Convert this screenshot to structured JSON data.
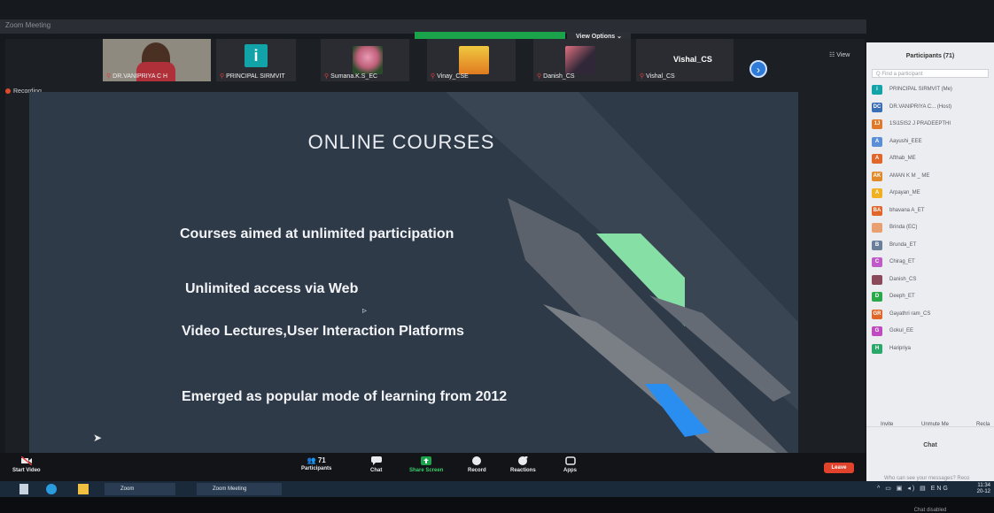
{
  "app": {
    "title": "Zoom Meeting",
    "view_options_label": "View Options ⌄",
    "view_label": "☷ View",
    "recording_label": "Recording"
  },
  "gallery": [
    {
      "name": "DR.VANIPRIYA C H",
      "muted": true
    },
    {
      "name": "PRINCIPAL SIRMVIT",
      "muted": true,
      "initial": "i"
    },
    {
      "name": "Sumana.K.S_EC",
      "muted": true
    },
    {
      "name": "Vinay_CSE",
      "muted": true
    },
    {
      "name": "Danish_CS",
      "muted": true
    },
    {
      "name": "Vishal_CS",
      "muted": true,
      "big_label": "Vishal_CS"
    }
  ],
  "slide": {
    "title": "ONLINE COURSES",
    "bullets": [
      "Courses aimed at unlimited participation",
      "Unlimited access via Web",
      "Video Lectures,User Interaction Platforms",
      "Emerged as popular mode of learning from 2012"
    ],
    "accent_colors": {
      "green": "#86e0a6",
      "blue": "#2a8ef0",
      "background": "#2f3a48",
      "stripe": "#7a7f86"
    }
  },
  "toolbar": {
    "start_video": "Start Video",
    "participants": "Participants",
    "participants_count": "71",
    "chat": "Chat",
    "share_screen": "Share Screen",
    "record": "Record",
    "reactions": "Reactions",
    "apps": "Apps",
    "leave": "Leave"
  },
  "participants_panel": {
    "title": "Participants (71)",
    "find_placeholder": "Q Find a participant",
    "participants": [
      {
        "initials": "i",
        "name": "PRINCIPAL SIRMVIT (Me)",
        "color": "#12a3a8"
      },
      {
        "initials": "DC",
        "name": "DR.VANIPRIYA C... (Host)",
        "color": "#3a6fb5"
      },
      {
        "initials": "1J",
        "name": "1Si15IS2 J PRADEEPTHI",
        "color": "#e07a2a"
      },
      {
        "initials": "A",
        "name": "Aayushi_EEE",
        "color": "#5a8fd8"
      },
      {
        "initials": "A",
        "name": "Afthab_ME",
        "color": "#e0662a"
      },
      {
        "initials": "AK",
        "name": "AMAN K M _ ME",
        "color": "#e08a2a"
      },
      {
        "initials": "A",
        "name": "Arpayan_ME",
        "color": "#f0b020"
      },
      {
        "initials": "BA",
        "name": "bhavana A_ET",
        "color": "#e0662a"
      },
      {
        "initials": "",
        "name": "Brinda (EC)",
        "color": "#e8a070"
      },
      {
        "initials": "B",
        "name": "Brunda_ET",
        "color": "#6a7f9a"
      },
      {
        "initials": "C",
        "name": "Chirag_ET",
        "color": "#c05ac8"
      },
      {
        "initials": "",
        "name": "Danish_CS",
        "color": "#8a4a5a"
      },
      {
        "initials": "D",
        "name": "Deeph_ET",
        "color": "#2aa84a"
      },
      {
        "initials": "GR",
        "name": "Gayathri ram_CS",
        "color": "#e0662a"
      },
      {
        "initials": "G",
        "name": "Gokul_EE",
        "color": "#c04ac0"
      },
      {
        "initials": "H",
        "name": "Haripriya",
        "color": "#2aa86a"
      }
    ],
    "invite": "Invite",
    "unmute_me": "Unmute Me",
    "reclaim": "Recla",
    "chat_title": "Chat",
    "chat_who": "Who can see your messages? Reco",
    "chat_disabled": "Chat disabled"
  },
  "taskbar": {
    "app1": "Zoom",
    "app2": "Zoom Meeting",
    "lang": "ENG",
    "time": "11:34",
    "date": "20-12"
  }
}
